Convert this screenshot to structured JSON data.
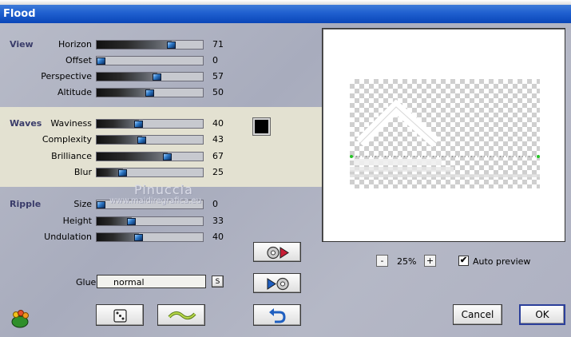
{
  "window": {
    "title": "Flood"
  },
  "sections": {
    "view": "View",
    "waves": "Waves",
    "ripple": "Ripple"
  },
  "sliders": {
    "horizon": {
      "label": "Horizon",
      "value": 71
    },
    "offset": {
      "label": "Offset",
      "value": 0
    },
    "perspective": {
      "label": "Perspective",
      "value": 57
    },
    "altitude": {
      "label": "Altitude",
      "value": 50
    },
    "waviness": {
      "label": "Waviness",
      "value": 40
    },
    "complexity": {
      "label": "Complexity",
      "value": 43
    },
    "brilliance": {
      "label": "Brilliance",
      "value": 67
    },
    "blur": {
      "label": "Blur",
      "value": 25
    },
    "size": {
      "label": "Size",
      "value": 0
    },
    "height": {
      "label": "Height",
      "value": 33
    },
    "undulation": {
      "label": "Undulation",
      "value": 40
    }
  },
  "color": {
    "swatch": "#000000"
  },
  "glue": {
    "label": "Glue",
    "value": "normal",
    "s_button": "S"
  },
  "preview": {
    "zoom": "25%",
    "minus": "-",
    "plus": "+",
    "auto_preview_label": "Auto preview",
    "auto_preview_checked": "✔"
  },
  "buttons": {
    "cancel": "Cancel",
    "ok": "OK"
  },
  "watermark": {
    "line1": "Pinuccia",
    "line2": "www.maidiregrafica.eu"
  }
}
